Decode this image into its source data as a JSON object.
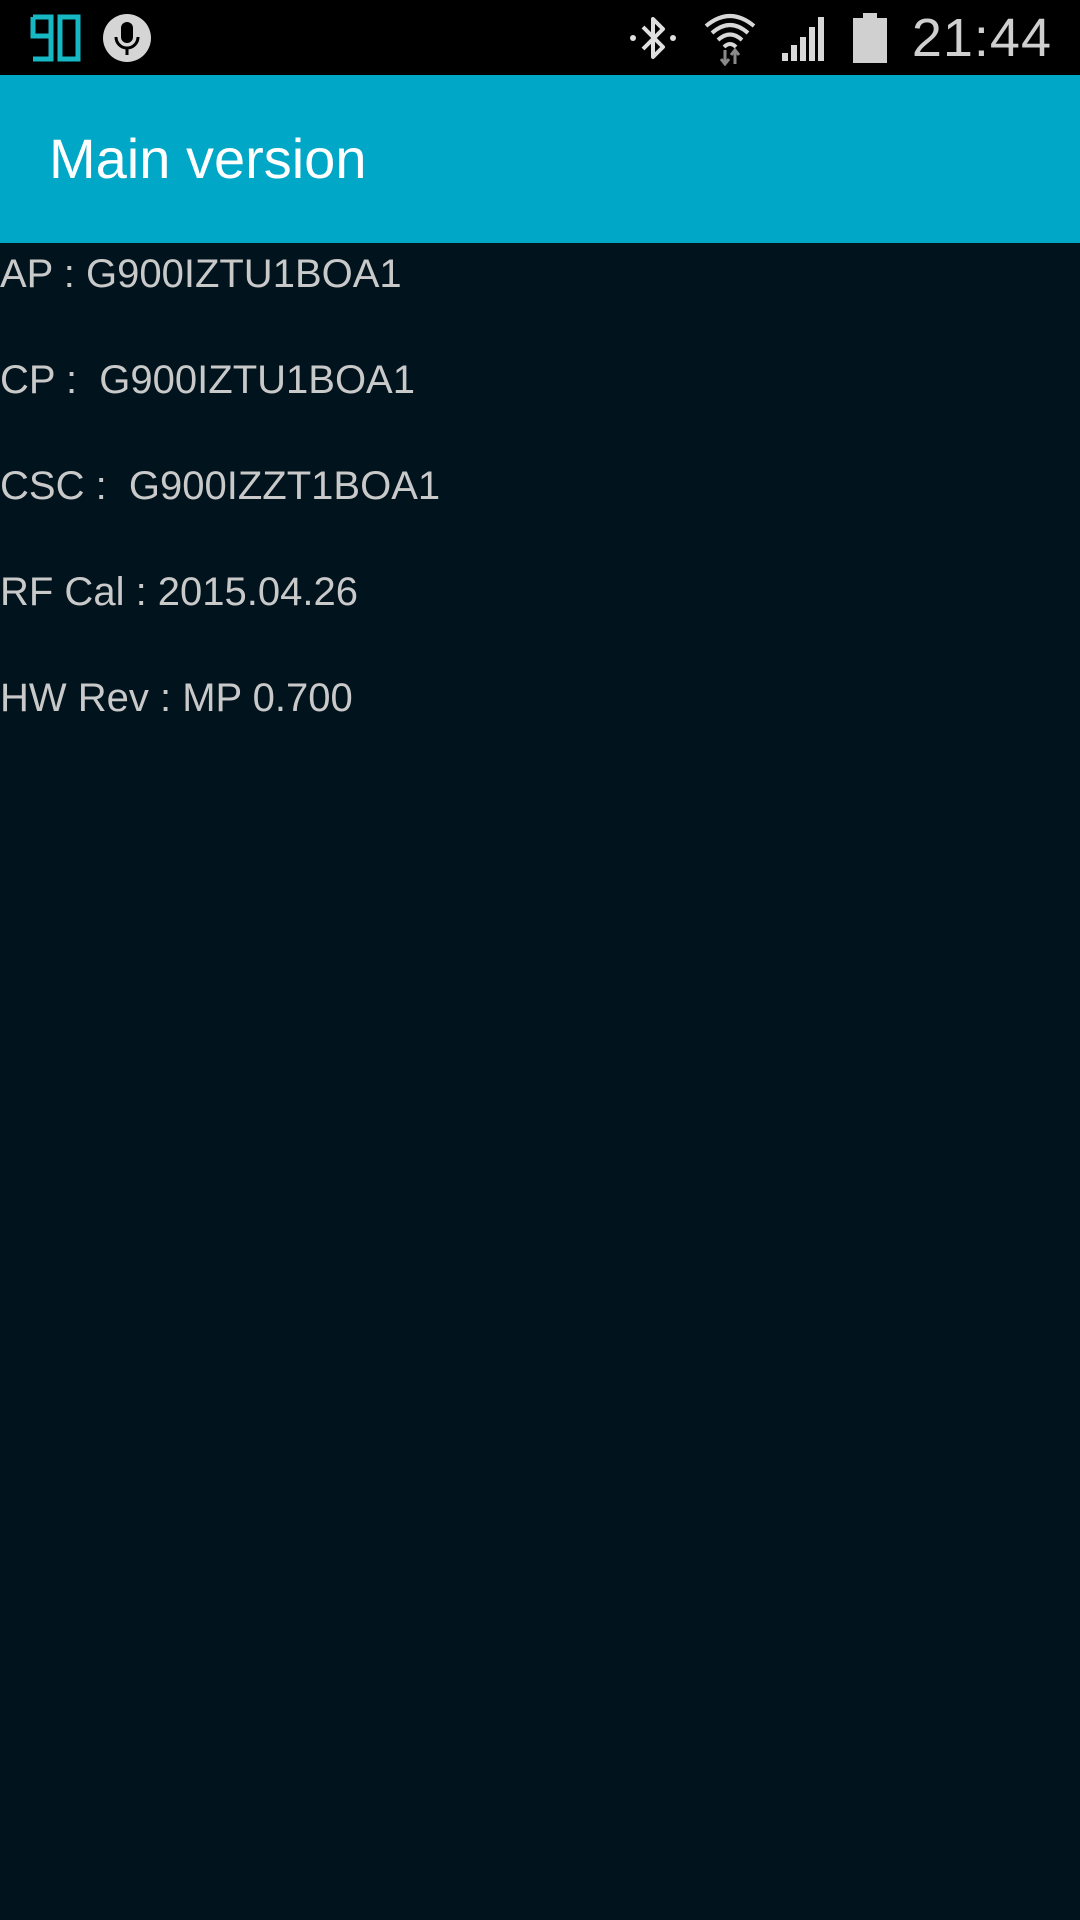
{
  "status_bar": {
    "app_badge": "90",
    "time": "21:44",
    "icons": [
      "mic-icon",
      "bluetooth-icon",
      "wifi-icon",
      "signal-icon",
      "battery-icon"
    ]
  },
  "action_bar": {
    "title": "Main version",
    "color": "#00a7c6"
  },
  "info": [
    {
      "text": "AP : G900IZTU1BOA1"
    },
    {
      "text": "CP :  G900IZTU1BOA1"
    },
    {
      "text": "CSC :  G900IZZT1BOA1"
    },
    {
      "text": "RF Cal : 2015.04.26"
    },
    {
      "text": "HW Rev : MP 0.700"
    }
  ]
}
